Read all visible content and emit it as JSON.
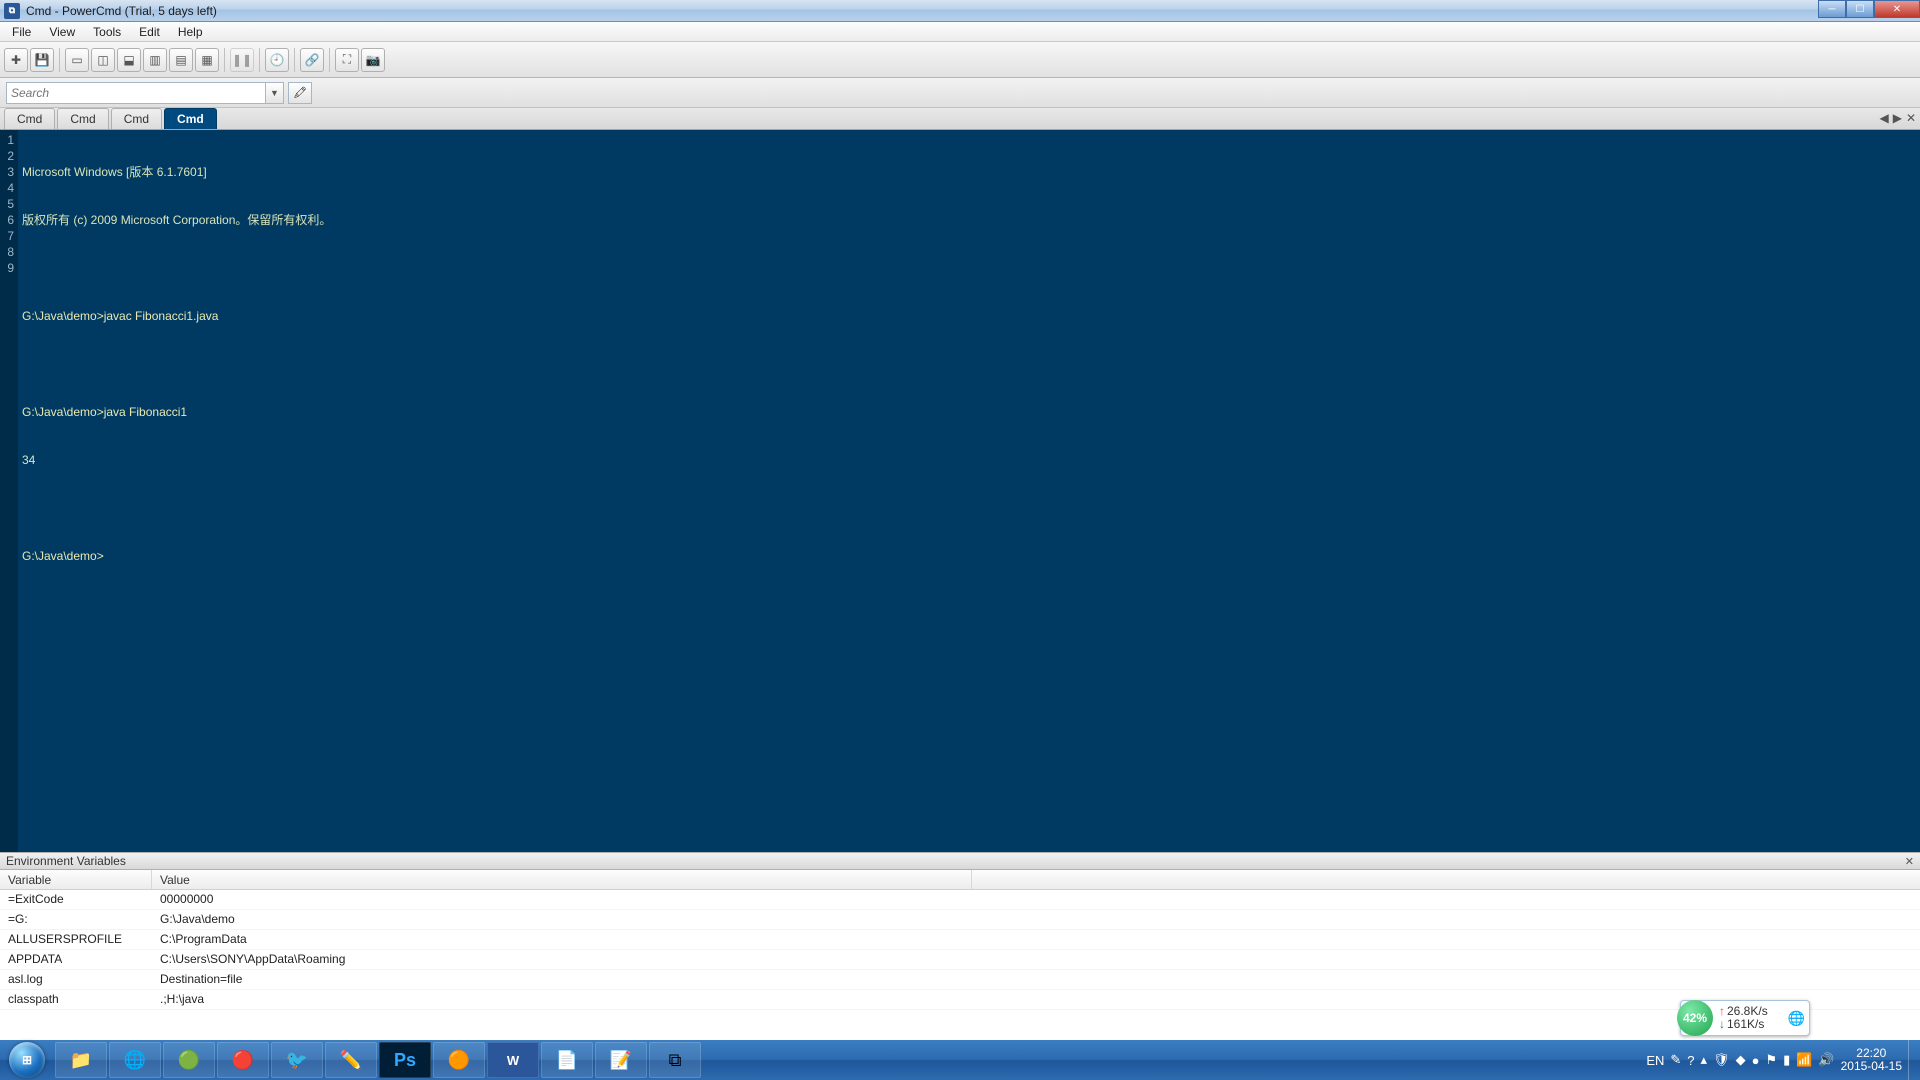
{
  "titlebar": {
    "title": "Cmd - PowerCmd (Trial, 5 days left)"
  },
  "menubar": {
    "items": [
      "File",
      "View",
      "Tools",
      "Edit",
      "Help"
    ]
  },
  "search": {
    "placeholder": "Search"
  },
  "tabs": {
    "items": [
      "Cmd",
      "Cmd",
      "Cmd",
      "Cmd"
    ],
    "active_index": 3
  },
  "terminal": {
    "lines": [
      "Microsoft Windows [版本 6.1.7601]",
      "版权所有 (c) 2009 Microsoft Corporation。保留所有权利。",
      "",
      "G:\\Java\\demo>javac Fibonacci1.java",
      "",
      "G:\\Java\\demo>java Fibonacci1",
      "34",
      "",
      "G:\\Java\\demo>"
    ]
  },
  "env_panel": {
    "title": "Environment Variables",
    "columns": {
      "variable": "Variable",
      "value": "Value"
    },
    "rows": [
      {
        "variable": "=ExitCode",
        "value": "00000000"
      },
      {
        "variable": "=G:",
        "value": "G:\\Java\\demo"
      },
      {
        "variable": "ALLUSERSPROFILE",
        "value": "C:\\ProgramData"
      },
      {
        "variable": "APPDATA",
        "value": "C:\\Users\\SONY\\AppData\\Roaming"
      },
      {
        "variable": "asl.log",
        "value": "Destination=file"
      },
      {
        "variable": "classpath",
        "value": ".;H:\\java"
      }
    ]
  },
  "netwidget": {
    "percent": "42%",
    "up": "26.8K/s",
    "down": "161K/s"
  },
  "tray": {
    "ime": "EN",
    "time": "22:20",
    "date": "2015-04-15"
  }
}
